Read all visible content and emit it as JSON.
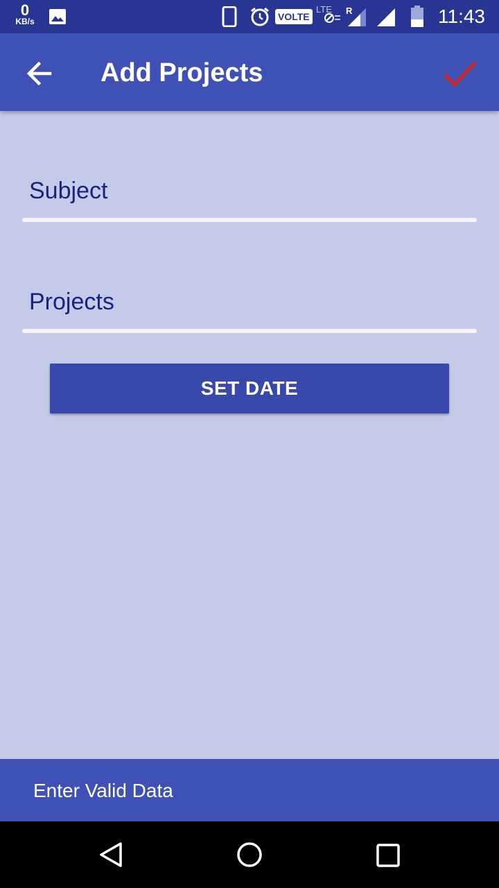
{
  "status_bar": {
    "net_speed_value": "0",
    "net_speed_unit": "KB/s",
    "volte_label": "VOLTE",
    "time": "11:43",
    "icons": [
      "gallery-icon",
      "phone-icon",
      "alarm-icon",
      "volte-icon",
      "lte-icon",
      "signal-roaming-icon",
      "signal-icon",
      "battery-icon"
    ]
  },
  "app_bar": {
    "title": "Add Projects",
    "back_icon": "arrow-back-icon",
    "confirm_icon": "check-icon",
    "confirm_color": "#c62828"
  },
  "form": {
    "subject_placeholder": "Subject",
    "projects_placeholder": "Projects",
    "set_date_label": "SET DATE"
  },
  "snackbar": {
    "message": "Enter Valid Data"
  },
  "nav_bar": {
    "icons": [
      "nav-back-icon",
      "nav-home-icon",
      "nav-recents-icon"
    ]
  },
  "colors": {
    "status_bar": "#283593",
    "primary": "#3f51b5",
    "background": "#c5cae9",
    "text_primary_dark": "#1a237e",
    "button": "#3949ab"
  }
}
